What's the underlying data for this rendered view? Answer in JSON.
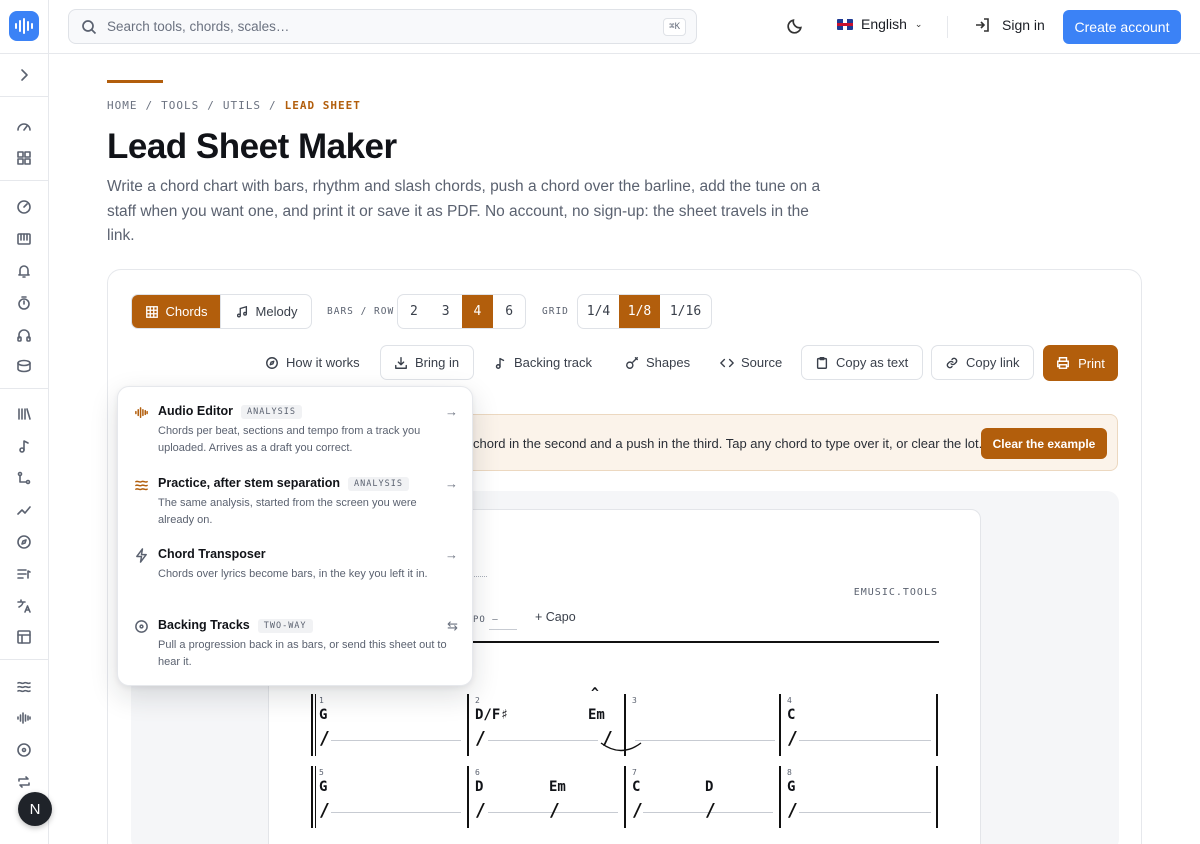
{
  "topbar": {
    "search_placeholder": "Search tools, chords, scales…",
    "search_shortcut": "⌘K",
    "language": "English",
    "sign_in": "Sign in",
    "create_account": "Create account"
  },
  "breadcrumb": [
    "HOME",
    "TOOLS",
    "UTILS",
    "LEAD SHEET"
  ],
  "breadcrumb_sep": "/",
  "page": {
    "title": "Lead Sheet Maker",
    "description": "Write a chord chart with bars, rhythm and slash chords, push a chord over the barline, add the tune on a staff when you want one, and print it or save it as PDF. No account, no sign-up: the sheet travels in the link."
  },
  "toolbar": {
    "mode_tabs": [
      {
        "label": "Chords",
        "active": true
      },
      {
        "label": "Melody",
        "active": false
      }
    ],
    "bars_label": "BARS / ROW",
    "bars_options": [
      "2",
      "3",
      "4",
      "6"
    ],
    "bars_selected": "4",
    "grid_label": "GRID",
    "grid_options": [
      "1/4",
      "1/8",
      "1/16"
    ],
    "grid_selected": "1/8",
    "how_it_works": "How it works",
    "bring_in": "Bring in",
    "backing_track": "Backing track",
    "shapes": "Shapes",
    "source": "Source",
    "copy_as_text": "Copy as text",
    "copy_link": "Copy link",
    "print": "Print"
  },
  "notice": {
    "text": "chord in the second and a push in the third. Tap any chord to type over it, or clear the lot.",
    "clear_button": "Clear the example"
  },
  "bring_in_menu": [
    {
      "title": "Audio Editor",
      "badge": "ANALYSIS",
      "desc": "Chords per beat, sections and tempo from a track you uploaded. Arrives as a draft you correct.",
      "arrow": "→",
      "icon": "waveform-icon"
    },
    {
      "title": "Practice, after stem separation",
      "badge": "ANALYSIS",
      "desc": "The same analysis, started from the screen you were already on.",
      "arrow": "→",
      "icon": "waves-icon"
    },
    {
      "title": "Chord Transposer",
      "badge": "",
      "desc": "Chords over lyrics become bars, in the key you left it in.",
      "arrow": "→",
      "icon": "lightning-icon"
    },
    {
      "title": "Backing Tracks",
      "badge": "TWO-WAY",
      "desc": "Pull a progression back in as bars, or send this sheet out to hear it.",
      "arrow": "⇆",
      "icon": "disc-icon"
    }
  ],
  "sheet": {
    "brand": "EMUSIC.TOOLS",
    "tempo_label": "PO",
    "tempo_value": "—",
    "capo_label": "+ Capo",
    "bars": [
      {
        "n": "1",
        "chords": [
          "G"
        ]
      },
      {
        "n": "2",
        "chords": [
          "D/F♯",
          "Em"
        ]
      },
      {
        "n": "3",
        "chords": []
      },
      {
        "n": "4",
        "chords": [
          "C"
        ]
      },
      {
        "n": "5",
        "chords": [
          "G"
        ]
      },
      {
        "n": "6",
        "chords": [
          "D",
          "Em"
        ]
      },
      {
        "n": "7",
        "chords": [
          "C",
          "D"
        ]
      },
      {
        "n": "8",
        "chords": [
          "G"
        ]
      }
    ],
    "push_mark": "^",
    "slash": "/"
  },
  "user": {
    "avatar_initial": "N"
  },
  "colors": {
    "accent": "#b25e0c",
    "brand_blue": "#3b82f6"
  }
}
